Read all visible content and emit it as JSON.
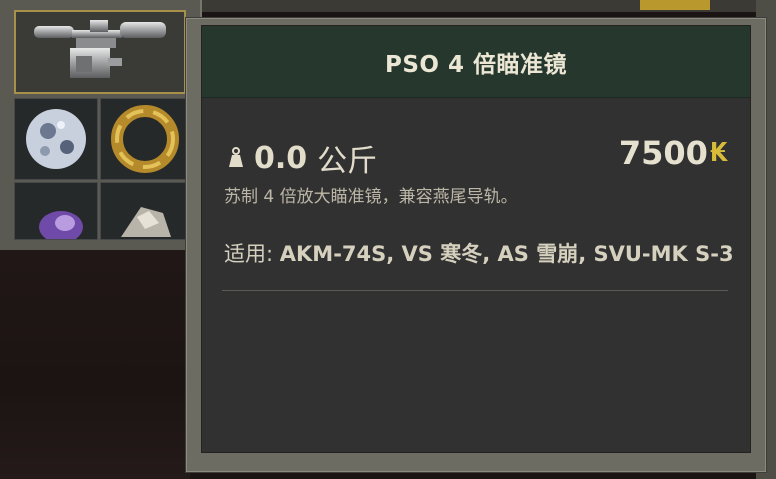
{
  "inventory": {
    "slots": [
      {
        "name": "scope-item-slot",
        "icon": "scope-icon",
        "selected": true
      },
      {
        "name": "gem-item-slot",
        "icon": "crystal-orb-icon",
        "selected": false
      },
      {
        "name": "ring-item-slot",
        "icon": "golden-ring-icon",
        "selected": false
      },
      {
        "name": "purple-item-slot",
        "icon": "purple-artifact-icon",
        "selected": false
      },
      {
        "name": "silver-item-slot",
        "icon": "silver-artifact-icon",
        "selected": false
      }
    ],
    "selected_border_color": "#a6904a"
  },
  "tooltip": {
    "title": "PSO 4 倍瞄准镜",
    "header_color": "#26382e",
    "weight": {
      "icon": "weight-icon",
      "value": "0.0",
      "unit": "公斤"
    },
    "price": {
      "value": "7500",
      "currency_icon": "ruble-coin-icon",
      "currency_symbol": "₭",
      "currency_color": "#d9bb3a"
    },
    "description": "苏制 4 倍放大瞄准镜，兼容燕尾导轨。",
    "compatibility": {
      "label": "适用: ",
      "weapons": "AKM-74S, VS 寒冬, AS 雪崩, SVU-MK S-3"
    }
  }
}
